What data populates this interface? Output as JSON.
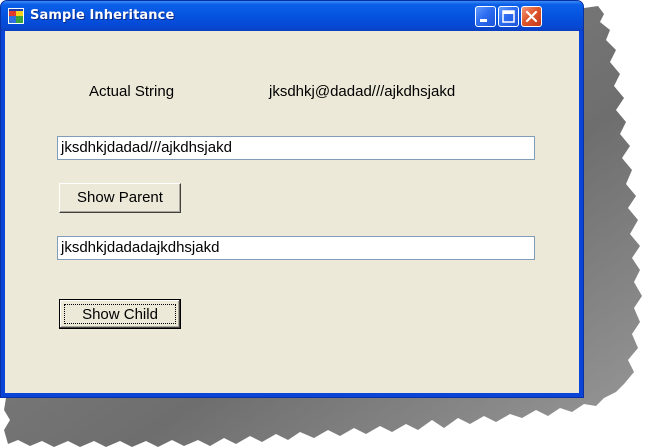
{
  "window": {
    "title": "Sample Inheritance",
    "accent_color": "#0553e0",
    "close_color": "#e0572b",
    "client_color": "#ece9d8"
  },
  "caption_buttons": {
    "minimize_icon": "minimize-icon",
    "maximize_icon": "maximize-icon",
    "close_icon": "close-icon"
  },
  "form": {
    "actual_label": "Actual String",
    "actual_value": "jksdhkj@dadad///ajkdhsjakd",
    "parent_output": "jksdhkjdadad///ajkdhsjakd",
    "show_parent_label": "Show Parent",
    "child_output": "jksdhkjdadadajkdhsjakd",
    "show_child_label": "Show Child"
  }
}
